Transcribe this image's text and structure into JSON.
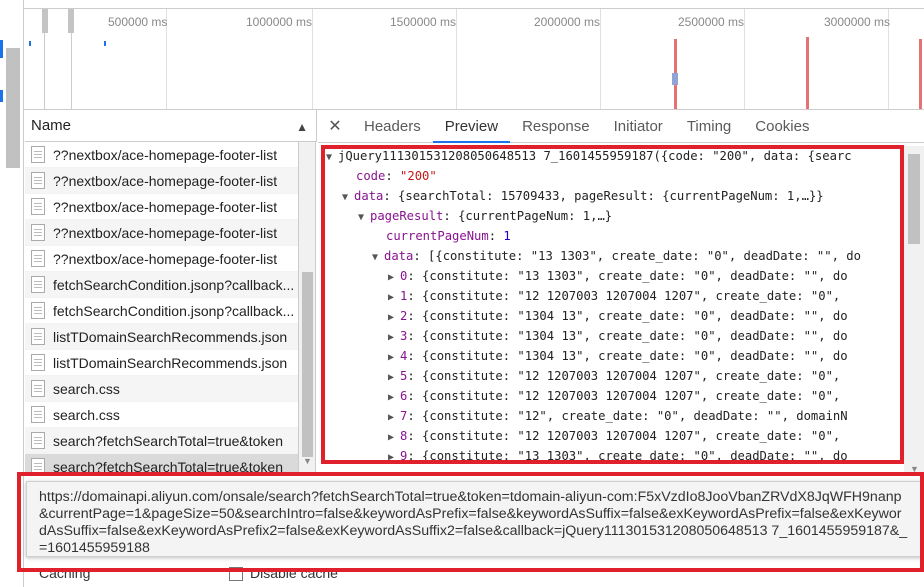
{
  "overview": {
    "tick_labels": [
      "500000 ms",
      "1000000 ms",
      "1500000 ms",
      "2000000 ms",
      "2500000 ms",
      "3000000 ms"
    ]
  },
  "requests": {
    "header": "Name",
    "items": [
      "??nextbox/ace-homepage-footer-list",
      "??nextbox/ace-homepage-footer-list",
      "??nextbox/ace-homepage-footer-list",
      "??nextbox/ace-homepage-footer-list",
      "??nextbox/ace-homepage-footer-list",
      "fetchSearchCondition.jsonp?callback...",
      "fetchSearchCondition.jsonp?callback...",
      "listTDomainSearchRecommends.json",
      "listTDomainSearchRecommends.json",
      "search.css",
      "search.css",
      "search?fetchSearchTotal=true&token",
      "search?fetchSearchTotal=true&token"
    ],
    "selected_index": 12
  },
  "tabs": [
    "Headers",
    "Preview",
    "Response",
    "Initiator",
    "Timing",
    "Cookies"
  ],
  "active_tab": "Preview",
  "preview": {
    "root": "jQuery111301531208050648513 7_1601455959187({code: \"200\", data: {searc",
    "code_key": "code",
    "code_val": "\"200\"",
    "data_key": "data",
    "data_val": "{searchTotal: 15709433, pageResult: {currentPageNum: 1,…}}",
    "pageResult_key": "pageResult",
    "pageResult_val": "{currentPageNum: 1,…}",
    "currentPageNum_key": "currentPageNum",
    "currentPageNum_val": "1",
    "data_arr_key": "data",
    "data_arr_val": "[{constitute: \"13 1303\", create_date: \"0\", deadDate: \"\", do",
    "rows": [
      {
        "idx": "0",
        "text": "{constitute: \"13 1303\", create_date: \"0\", deadDate: \"\", do"
      },
      {
        "idx": "1",
        "text": "{constitute: \"12 1207003 1207004 1207\", create_date: \"0\","
      },
      {
        "idx": "2",
        "text": "{constitute: \"1304 13\", create_date: \"0\", deadDate: \"\", do"
      },
      {
        "idx": "3",
        "text": "{constitute: \"1304 13\", create_date: \"0\", deadDate: \"\", do"
      },
      {
        "idx": "4",
        "text": "{constitute: \"1304 13\", create_date: \"0\", deadDate: \"\", do"
      },
      {
        "idx": "5",
        "text": "{constitute: \"12 1207003 1207004 1207\", create_date: \"0\","
      },
      {
        "idx": "6",
        "text": "{constitute: \"12 1207003 1207004 1207\", create_date: \"0\","
      },
      {
        "idx": "7",
        "text": "{constitute: \"12\", create_date: \"0\", deadDate: \"\", domainN"
      },
      {
        "idx": "8",
        "text": "{constitute: \"12 1207003 1207004 1207\", create_date: \"0\","
      },
      {
        "idx": "9",
        "text": "{constitute: \"13 1303\", create_date: \"0\", deadDate: \"\", do"
      }
    ]
  },
  "tooltip": {
    "url": "https://domainapi.aliyun.com/onsale/search?fetchSearchTotal=true&token=tdomain-aliyun-com:F5xVzdIo8JooVbanZRVdX8JqWFH9nanp&currentPage=1&pageSize=50&searchIntro=false&keywordAsPrefix=false&keywordAsSuffix=false&exKeywordAsPrefix=false&exKeywordAsSuffix=false&exKeywordAsPrefix2=false&exKeywordAsSuffix2=false&callback=jQuery111301531208050648513 7_1601455959187&_=1601455959188"
  },
  "bottom": {
    "caching": "Caching",
    "disable_cache": "Disable cache"
  },
  "colors": {
    "highlight": "#e0202a",
    "tab_underline": "#1a73e8"
  }
}
